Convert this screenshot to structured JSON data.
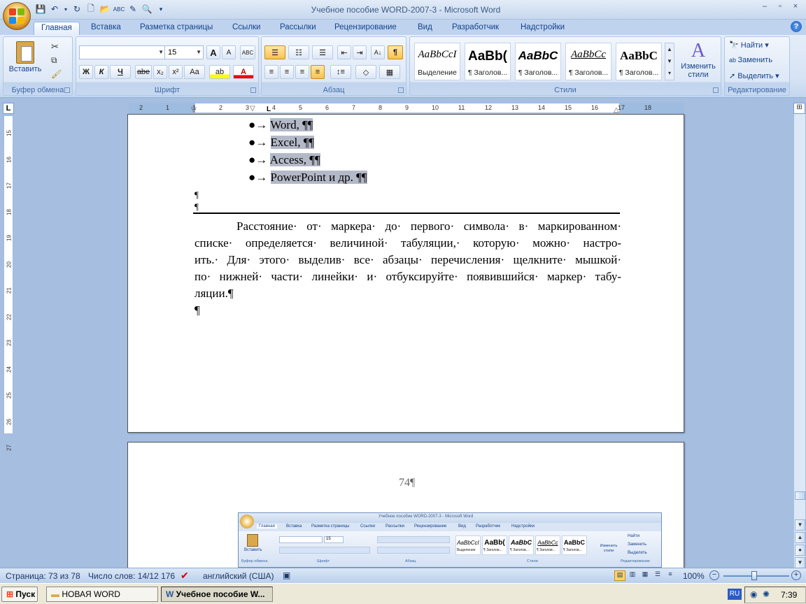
{
  "window": {
    "title": "Учебное пособие WORD-2007-3 - Microsoft Word",
    "controls": [
      "–",
      "▫",
      "×"
    ]
  },
  "tabs": [
    "Главная",
    "Вставка",
    "Разметка страницы",
    "Ссылки",
    "Рассылки",
    "Рецензирование",
    "Вид",
    "Разработчик",
    "Надстройки"
  ],
  "clipboard": {
    "paste": "Вставить",
    "label": "Буфер обмена"
  },
  "font": {
    "name": "",
    "size": "15",
    "label": "Шрифт",
    "bold": "Ж",
    "italic": "К",
    "underline": "Ч",
    "strike": "abe",
    "sub": "x₂",
    "sup": "x²",
    "case": "Aa",
    "grow": "A",
    "shrink": "A"
  },
  "paragraph": {
    "label": "Абзац",
    "show_marks": "¶"
  },
  "styles": {
    "label": "Стили",
    "items": [
      {
        "sample": "AaBbCcI",
        "name": "Выделение"
      },
      {
        "sample": "AaBb(",
        "name": "¶ Заголов..."
      },
      {
        "sample": "AaBbC",
        "name": "¶ Заголов..."
      },
      {
        "sample": "AaBbCc",
        "name": "¶ Заголов..."
      },
      {
        "sample": "AaBbC",
        "name": "¶ Заголов..."
      }
    ],
    "change": "Изменить стили"
  },
  "editing": {
    "label": "Редактирование",
    "find": "Найти",
    "replace": "Заменить",
    "select": "Выделить"
  },
  "ruler": {
    "h_ticks": [
      "2",
      "1",
      "1",
      "2",
      "3",
      "4",
      "5",
      "6",
      "7",
      "8",
      "9",
      "10",
      "11",
      "12",
      "13",
      "14",
      "15",
      "16",
      "17",
      "18"
    ],
    "v_ticks": [
      "15",
      "16",
      "17",
      "18",
      "19",
      "20",
      "21",
      "22",
      "23",
      "24",
      "25",
      "26",
      "27"
    ],
    "corner": "L"
  },
  "document": {
    "bullets": [
      "Word, ¶¶",
      "Excel, ¶¶",
      "Access, ¶¶",
      "PowerPoint и др. ¶¶"
    ],
    "empty_marks": [
      "¶",
      "¶"
    ],
    "paragraph_lines": [
      "Расстояние· от· маркера· до· первого· символа· в· маркированном·",
      "списке· определяется· величиной· табуляции,· которую· можно· настро-",
      "ить.· Для· этого· выделив· все· абзацы· перечисления· щелкните· мышкой·",
      "по· нижней· части· линейки· и· отбуксируйте· появившийся· маркер· табу-",
      "ляции.¶"
    ],
    "trailing_mark": "¶",
    "page_number": "74¶"
  },
  "status": {
    "page": "Страница: 73 из 78",
    "words": "Число слов: 14/12 176",
    "language": "английский (США)",
    "zoom": "100%"
  },
  "taskbar": {
    "start": "Пуск",
    "items": [
      "НОВАЯ WORD",
      "Учебное пособие W..."
    ],
    "lang": "RU",
    "clock": "7:39"
  },
  "mini": {
    "title": "Учебное пособие WORD-2007-3 - Microsoft Word",
    "tabs": [
      "Главная",
      "Вставка",
      "Разметка страницы",
      "Ссылки",
      "Рассылки",
      "Рецензирование",
      "Вид",
      "Разработчик",
      "Надстройки"
    ],
    "paste": "Вставить",
    "size": "15",
    "styles": [
      "AaBbCcI",
      "AaBb(",
      "AaBbC",
      "AaBbCc",
      "AaBbC"
    ],
    "style_names": [
      "Выделение",
      "¶ Заголов...",
      "¶ Заголов...",
      "¶ Заголов...",
      "¶ Заголов..."
    ],
    "change": "Изменить стили",
    "find": "Найти",
    "replace": "Заменить",
    "select": "Выделить",
    "groups": [
      "Буфер обмена",
      "Шрифт",
      "Абзац",
      "Стили",
      "Редактирование"
    ]
  },
  "colors": {
    "accent": "#15428b",
    "selection": "#b4b9c8",
    "page_bg": "#a6bfe0"
  }
}
